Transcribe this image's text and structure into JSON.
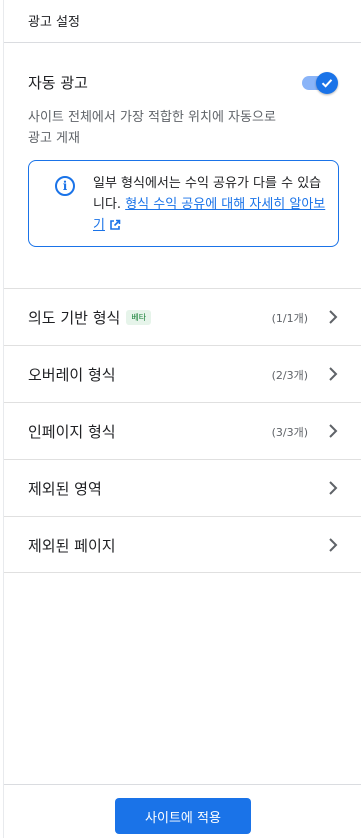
{
  "header": {
    "title": "광고 설정"
  },
  "auto_ads": {
    "title": "자동 광고",
    "description": "사이트 전체에서 가장 적합한 위치에 자동으로 광고 게재",
    "enabled": true
  },
  "info": {
    "text": "일부 형식에서는 수익 공유가 다를 수 있습니다. ",
    "link": "형식 수익 공유에 대해 자세히 알아보기"
  },
  "rows": [
    {
      "label": "의도 기반 형식",
      "badge": "베타",
      "count": "(1/1개)"
    },
    {
      "label": "오버레이 형식",
      "count": "(2/3개)"
    },
    {
      "label": "인페이지 형식",
      "count": "(3/3개)"
    },
    {
      "label": "제외된 영역"
    },
    {
      "label": "제외된 페이지"
    }
  ],
  "footer": {
    "apply_label": "사이트에 적용"
  },
  "colors": {
    "accent": "#1a73e8",
    "beta_text": "#188038",
    "beta_bg": "#e6f4ea"
  },
  "icons": [
    "info-icon",
    "external-link-icon",
    "chevron-right-icon",
    "check-icon"
  ]
}
